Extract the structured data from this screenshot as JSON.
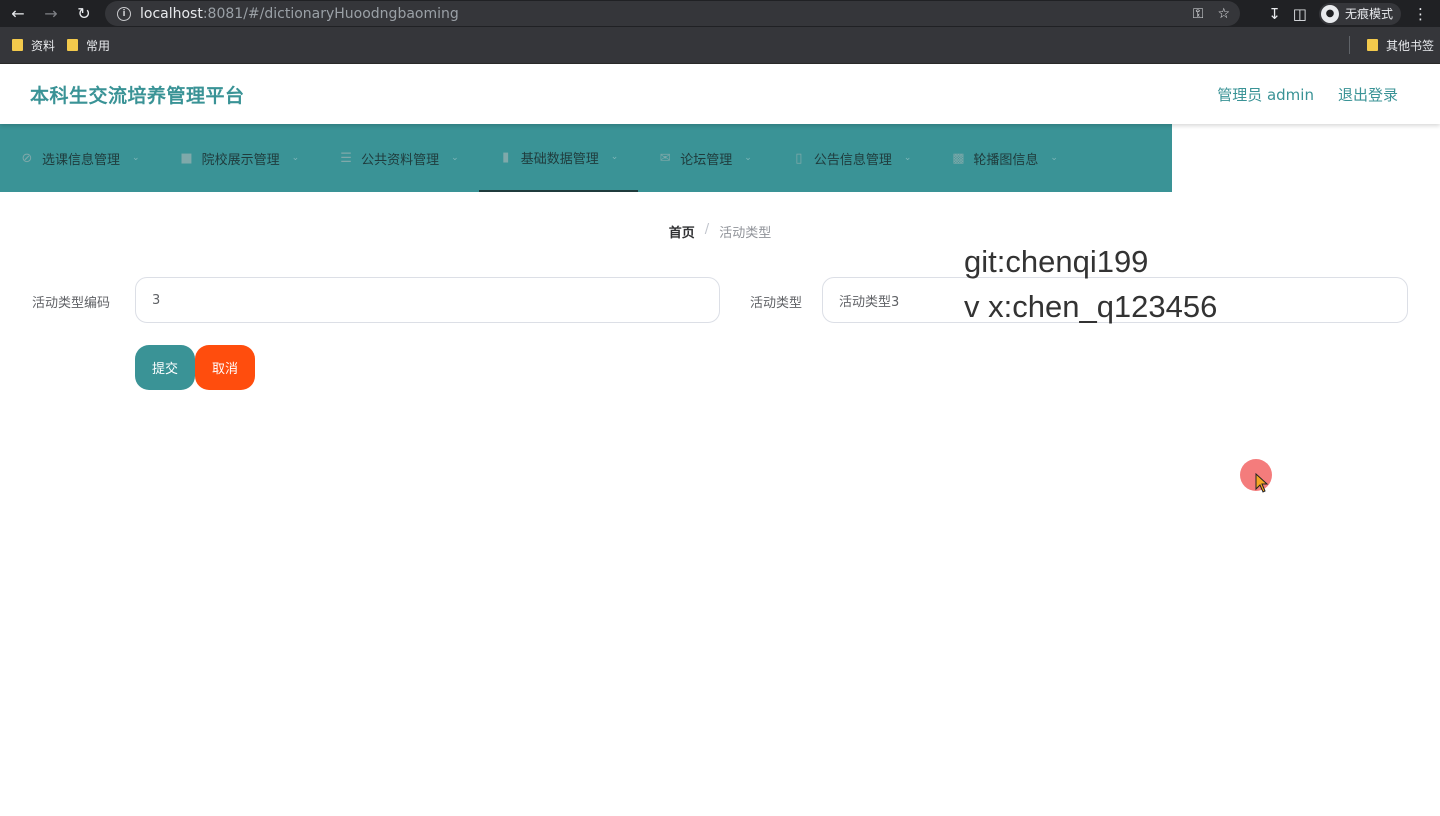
{
  "browser": {
    "url_host": "localhost",
    "url_rest": ":8081/#/dictionaryHuoodngbaoming",
    "incognito_label": "无痕模式",
    "bookmarks": [
      {
        "label": "资料"
      },
      {
        "label": "常用"
      }
    ],
    "other_bookmarks": "其他书签"
  },
  "header": {
    "title": "本科生交流培养管理平台",
    "user": "管理员 admin",
    "logout": "退出登录"
  },
  "menu": [
    {
      "label": "选课信息管理",
      "icon": "ban-icon"
    },
    {
      "label": "院校展示管理",
      "icon": "thumb-icon"
    },
    {
      "label": "公共资料管理",
      "icon": "sliders-icon"
    },
    {
      "label": "基础数据管理",
      "icon": "mic-icon",
      "active": true
    },
    {
      "label": "论坛管理",
      "icon": "mail-icon"
    },
    {
      "label": "公告信息管理",
      "icon": "phone-icon"
    },
    {
      "label": "轮播图信息",
      "icon": "clipboard-icon"
    }
  ],
  "breadcrumb": {
    "home": "首页",
    "separator": "/",
    "current": "活动类型"
  },
  "form": {
    "code_label": "活动类型编码",
    "code_value": "3",
    "type_label": "活动类型",
    "type_value": "活动类型3",
    "submit": "提交",
    "cancel": "取消"
  },
  "watermark": {
    "line1": "git:chenqi199",
    "line2": "v x:chen_q123456"
  },
  "colors": {
    "brand": "#3a9396",
    "cancel": "#ff4d0d"
  }
}
